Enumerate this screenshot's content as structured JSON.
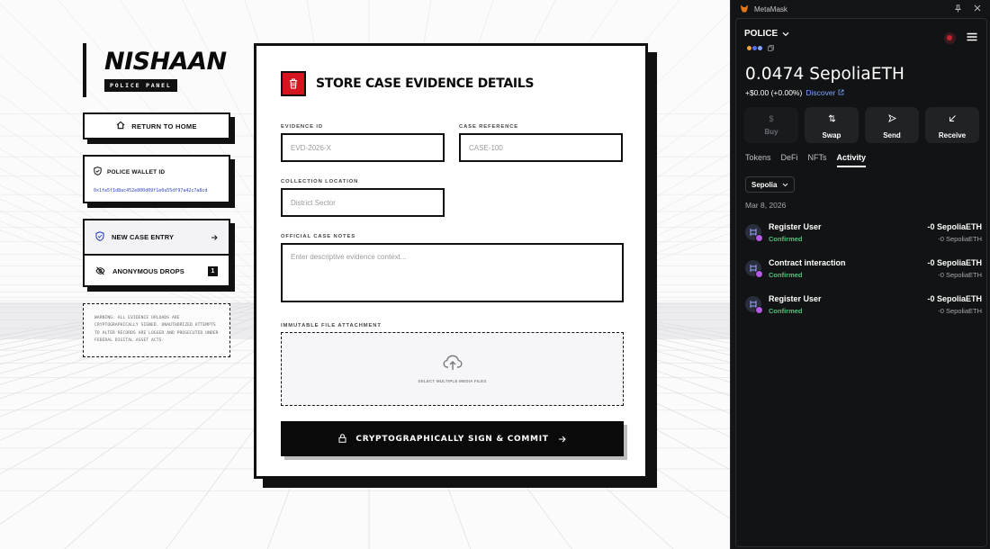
{
  "app": {
    "brand": "NISHAAN",
    "badge": "POLICE PANEL"
  },
  "sidebar": {
    "home_label": "RETURN TO HOME",
    "wallet_label": "POLICE WALLET ID",
    "wallet_address": "0x1fa5f1d8ac452e800d09f1e0a55df97a42c7a8cd",
    "menu": [
      {
        "label": "NEW CASE ENTRY",
        "icon": "shield-icon",
        "active": true
      },
      {
        "label": "ANONYMOUS DROPS",
        "icon": "eye-off-icon",
        "count": "1"
      }
    ],
    "warning": "WARNING: ALL EVIDENCE UPLOADS ARE CRYPTOGRAPHICALLY SIGNED. UNAUTHORIZED ATTEMPTS TO ALTER RECORDS ARE LOGGED AND PROSECUTED UNDER FEDERAL DIGITAL ASSET ACTS."
  },
  "form": {
    "title": "STORE CASE EVIDENCE DETAILS",
    "evidence_id_label": "EVIDENCE ID",
    "evidence_id_placeholder": "EVD-2026-X",
    "case_ref_label": "CASE REFERENCE",
    "case_ref_placeholder": "CASE-100",
    "location_label": "COLLECTION LOCATION",
    "location_placeholder": "District Sector",
    "notes_label": "OFFICIAL CASE NOTES",
    "notes_placeholder": "Enter descriptive evidence context...",
    "attach_label": "IMMUTABLE FILE ATTACHMENT",
    "attach_caption": "SELECT MULTIPLE MEDIA FILES",
    "commit_label": "CRYPTOGRAPHICALLY SIGN & COMMIT"
  },
  "metamask": {
    "window_title": "MetaMask",
    "account": "POLICE",
    "balance": "0.0474 SepoliaETH",
    "fiat_change": "+$0.00 (+0.00%)",
    "discover": "Discover",
    "actions": [
      {
        "label": "Buy",
        "disabled": true
      },
      {
        "label": "Swap"
      },
      {
        "label": "Send"
      },
      {
        "label": "Receive"
      }
    ],
    "tabs": [
      "Tokens",
      "DeFi",
      "NFTs",
      "Activity"
    ],
    "active_tab": "Activity",
    "network": "Sepolia",
    "date": "Mar 8, 2026",
    "transactions": [
      {
        "title": "Register User",
        "status": "Confirmed",
        "amount": "-0 SepoliaETH",
        "amount_sub": "-0 SepoliaETH"
      },
      {
        "title": "Contract interaction",
        "status": "Confirmed",
        "amount": "-0 SepoliaETH",
        "amount_sub": "-0 SepoliaETH"
      },
      {
        "title": "Register User",
        "status": "Confirmed",
        "amount": "-0 SepoliaETH",
        "amount_sub": "-0 SepoliaETH"
      }
    ],
    "colors": {
      "confirmed": "#4ec27a",
      "link": "#7ea7ff",
      "panel": "#131416"
    }
  }
}
